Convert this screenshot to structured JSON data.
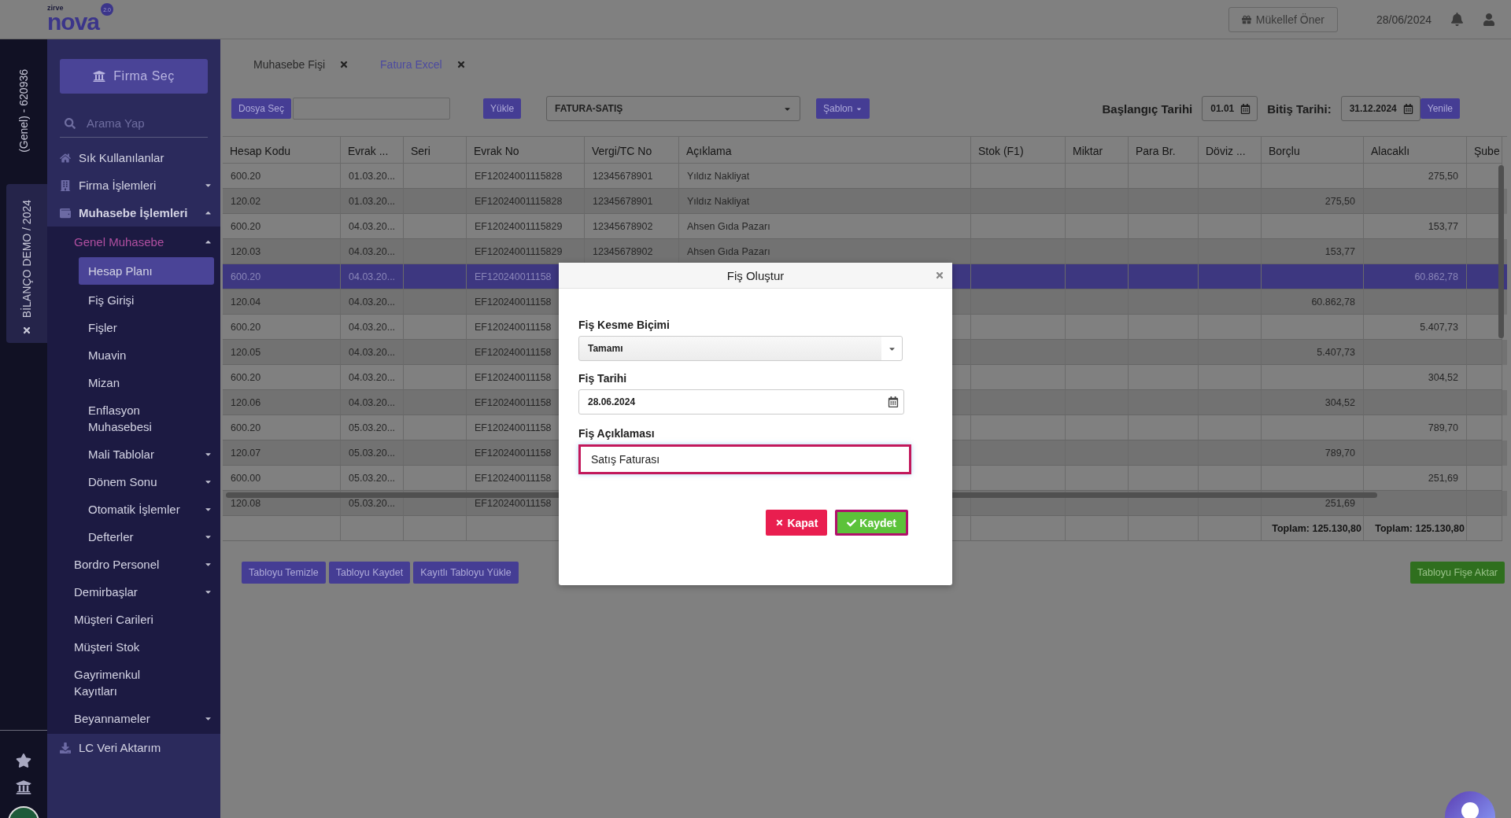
{
  "header": {
    "logo_small": "zirve",
    "logo": "nova",
    "logo_badge": "2.0",
    "suggest_button": "Mükellef Öner",
    "date": "28/06/2024"
  },
  "side_strip": {
    "account": "(Genel) - 620936",
    "company_tag": "BİLANÇO DEMO / 2024"
  },
  "sidebar": {
    "firm_button": "Firma Seç",
    "search_placeholder": "Arama Yap",
    "items": [
      {
        "label": "Sık Kullanılanlar",
        "selected": false
      },
      {
        "label": "Firma İşlemleri",
        "selected": false,
        "expanded": false
      },
      {
        "label": "Muhasebe İşlemleri",
        "selected": false,
        "expanded": true,
        "children": [
          {
            "label": "Genel Muhasebe",
            "selected": false,
            "expanded": true,
            "children": [
              {
                "label": "Hesap Planı",
                "selected": true
              },
              {
                "label": "Fiş Girişi",
                "selected": false
              },
              {
                "label": "Fişler",
                "selected": false
              },
              {
                "label": "Muavin",
                "selected": false
              },
              {
                "label": "Mizan",
                "selected": false
              },
              {
                "label": "Enflasyon Muhasebesi",
                "selected": false
              },
              {
                "label": "Mali Tablolar",
                "selected": false,
                "expanded": false
              },
              {
                "label": "Dönem Sonu",
                "selected": false,
                "expanded": false
              },
              {
                "label": "Otomatik İşlemler",
                "selected": false,
                "expanded": false
              },
              {
                "label": "Defterler",
                "selected": false,
                "expanded": false
              }
            ]
          },
          {
            "label": "Bordro Personel",
            "selected": false,
            "expanded": false
          },
          {
            "label": "Demirbaşlar",
            "selected": false,
            "expanded": false
          },
          {
            "label": "Müşteri Carileri",
            "selected": false
          },
          {
            "label": "Müşteri Stok",
            "selected": false
          },
          {
            "label": "Gayrimenkul Kayıtları",
            "selected": false
          },
          {
            "label": "Beyannameler",
            "selected": false,
            "expanded": false
          }
        ]
      },
      {
        "label": "LC Veri Aktarım",
        "selected": false
      }
    ]
  },
  "tabs": [
    {
      "label": "Muhasebe Fişi",
      "selected": false
    },
    {
      "label": "Fatura Excel",
      "selected": true
    }
  ],
  "toolbar": {
    "file_button": "Dosya Seç",
    "load_button": "Yükle",
    "template_select": "FATURA-SATIŞ",
    "template_button": "Şablon",
    "start_label": "Başlangıç Tarihi",
    "start_date": "01.01",
    "end_label": "Bitiş Tarihi:",
    "end_date": "31.12.2024",
    "refresh_button": "Yenile"
  },
  "table": {
    "columns": [
      "Hesap Kodu",
      "Evrak ...",
      "Seri",
      "Evrak No",
      "Vergi/TC No",
      "Açıklama",
      "Stok (F1)",
      "Miktar",
      "Para Br.",
      "Döviz ...",
      "Borçlu",
      "Alacaklı",
      "Şube"
    ],
    "rows": [
      {
        "selected": false,
        "hesap_kodu": "600.20",
        "evrak": "01.03.20...",
        "evrak_no": "EF12024001115828",
        "vergi_no": "12345678901",
        "aciklama": "Yıldız Nakliyat",
        "alacakli": "275,50"
      },
      {
        "selected": false,
        "hesap_kodu": "120.02",
        "evrak": "01.03.20...",
        "evrak_no": "EF12024001115828",
        "vergi_no": "12345678901",
        "aciklama": "Yıldız Nakliyat",
        "borclu": "275,50"
      },
      {
        "selected": false,
        "hesap_kodu": "600.20",
        "evrak": "04.03.20...",
        "evrak_no": "EF12024001115829",
        "vergi_no": "12345678902",
        "aciklama": "Ahsen Gıda Pazarı",
        "alacakli": "153,77"
      },
      {
        "selected": false,
        "hesap_kodu": "120.03",
        "evrak": "04.03.20...",
        "evrak_no": "EF12024001115829",
        "vergi_no": "12345678902",
        "aciklama": "Ahsen Gıda Pazarı",
        "borclu": "153,77"
      },
      {
        "selected": true,
        "hesap_kodu": "600.20",
        "evrak": "04.03.20...",
        "evrak_no": "EF120240011158",
        "alacakli": "60.862,78"
      },
      {
        "selected": false,
        "hesap_kodu": "120.04",
        "evrak": "04.03.20...",
        "evrak_no": "EF120240011158",
        "borclu": "60.862,78"
      },
      {
        "selected": false,
        "hesap_kodu": "600.20",
        "evrak": "04.03.20...",
        "evrak_no": "EF120240011158",
        "alacakli": "5.407,73"
      },
      {
        "selected": false,
        "hesap_kodu": "120.05",
        "evrak": "04.03.20...",
        "evrak_no": "EF120240011158",
        "borclu": "5.407,73"
      },
      {
        "selected": false,
        "hesap_kodu": "600.20",
        "evrak": "04.03.20...",
        "evrak_no": "EF120240011158",
        "alacakli": "304,52"
      },
      {
        "selected": false,
        "hesap_kodu": "120.06",
        "evrak": "04.03.20...",
        "evrak_no": "EF120240011158",
        "borclu": "304,52"
      },
      {
        "selected": false,
        "hesap_kodu": "600.20",
        "evrak": "05.03.20...",
        "evrak_no": "EF120240011158",
        "alacakli": "789,70"
      },
      {
        "selected": false,
        "hesap_kodu": "120.07",
        "evrak": "05.03.20...",
        "evrak_no": "EF120240011158",
        "borclu": "789,70"
      },
      {
        "selected": false,
        "hesap_kodu": "600.00",
        "evrak": "05.03.20...",
        "evrak_no": "EF120240011158",
        "alacakli": "251,69"
      },
      {
        "selected": false,
        "hesap_kodu": "120.08",
        "evrak": "05.03.20...",
        "evrak_no": "EF120240011158",
        "borclu": "251,69"
      }
    ],
    "totals": {
      "borclu": "Toplam: 125.130,80",
      "alacakli": "Toplam: 125.130,80"
    }
  },
  "table_buttons": [
    {
      "label": "Tabloyu Temizle",
      "kind": "primary"
    },
    {
      "label": "Tabloyu Kaydet",
      "kind": "primary"
    },
    {
      "label": "Kayıtlı Tabloyu Yükle",
      "kind": "primary"
    },
    {
      "label": "Tabloyu Fişe Aktar",
      "kind": "success"
    }
  ],
  "modal": {
    "title": "Fiş Oluştur",
    "type_label": "Fiş Kesme Biçimi",
    "type_value": "Tamamı",
    "date_label": "Fiş Tarihi",
    "date_value": "28.06.2024",
    "description_label": "Fiş Açıklaması",
    "description_value": "Satış Faturası",
    "description_focused": true,
    "buttons": [
      {
        "label": "Kapat",
        "kind": "danger",
        "focused": false
      },
      {
        "label": "Kaydet",
        "kind": "success",
        "focused": true
      }
    ]
  }
}
